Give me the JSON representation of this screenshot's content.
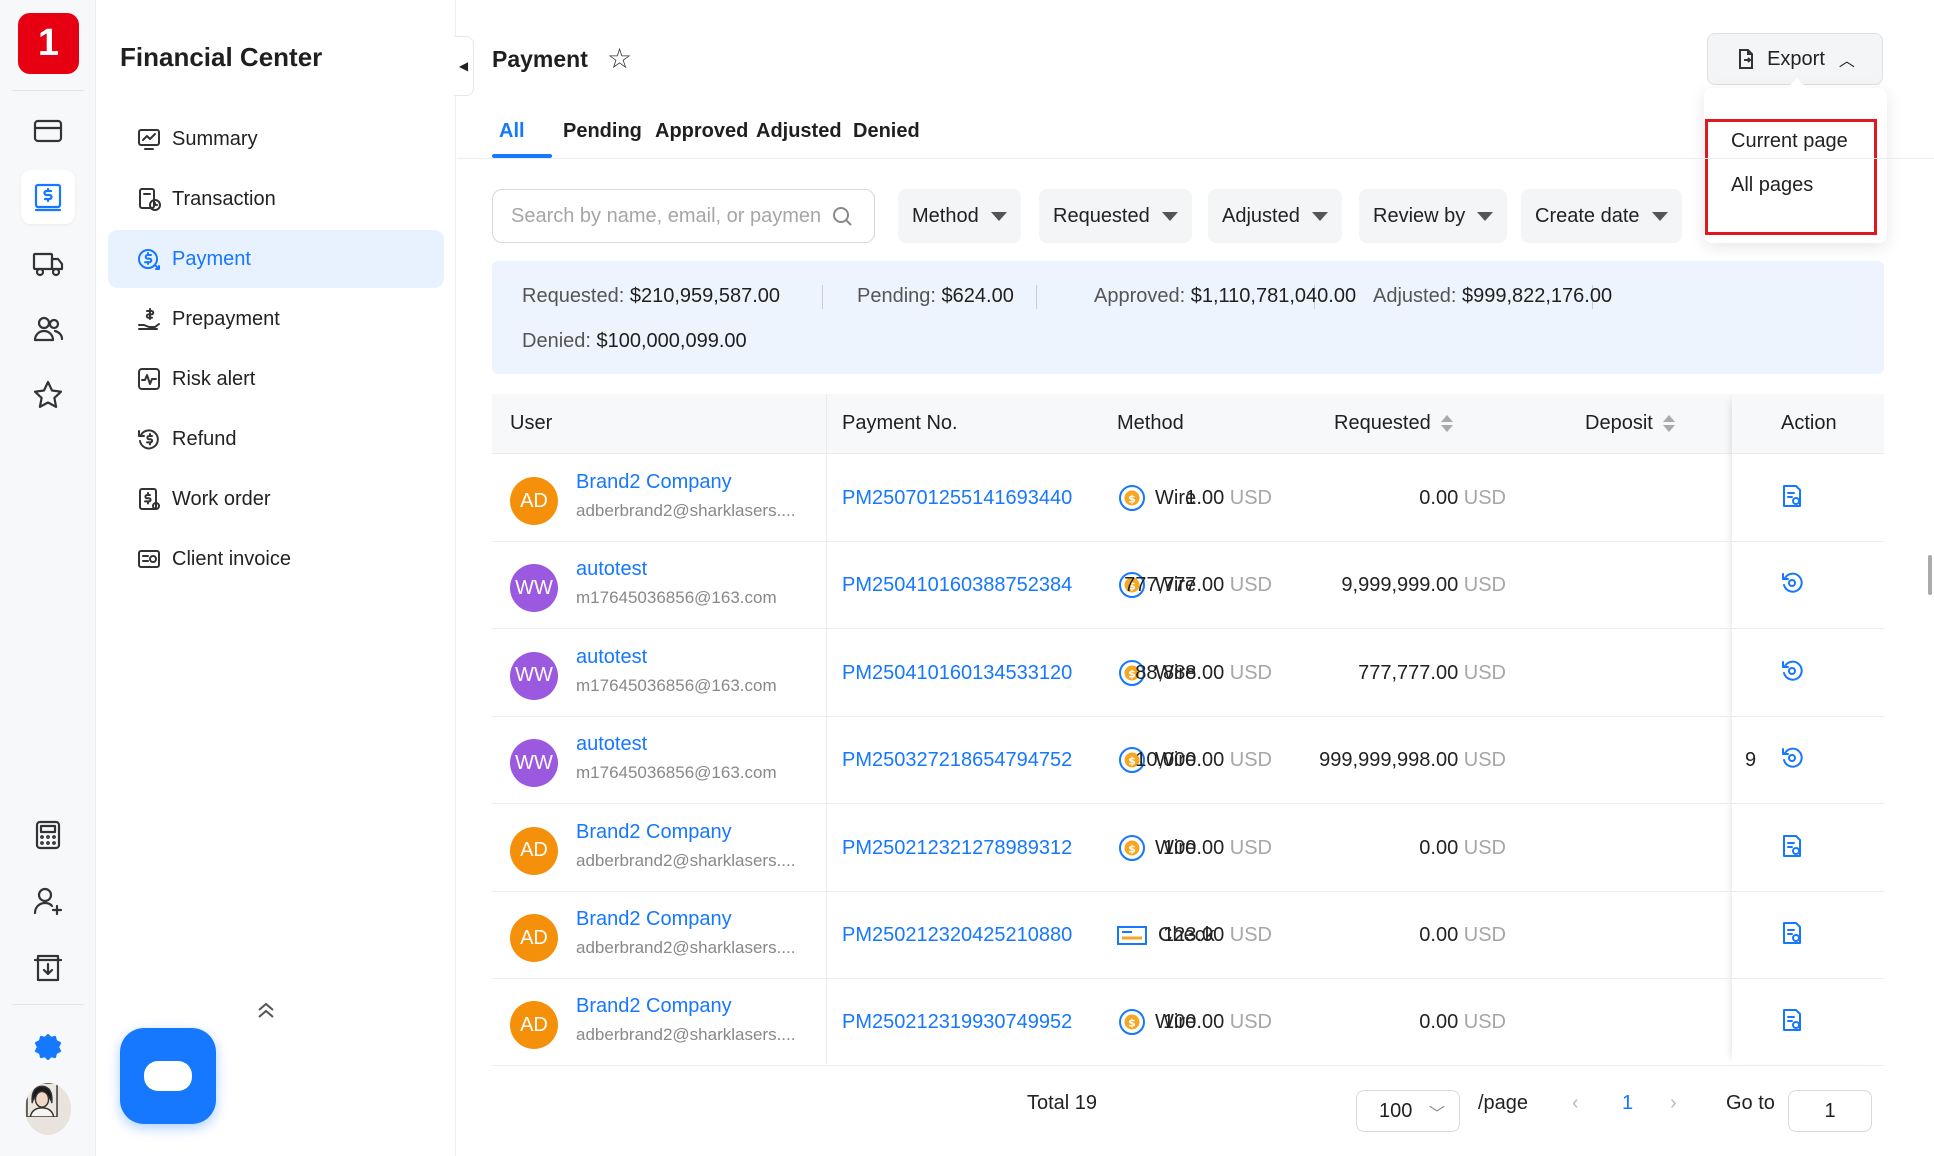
{
  "app": {
    "logo_text": "1",
    "accent": "#1677ff",
    "brand_red": "#e60012"
  },
  "rail": {
    "items": [
      {
        "icon": "card-icon"
      },
      {
        "icon": "dollar-doc-icon",
        "active": true
      },
      {
        "icon": "truck-icon"
      },
      {
        "icon": "users-icon"
      },
      {
        "icon": "star-icon"
      }
    ],
    "bottom_items": [
      {
        "icon": "calculator-icon"
      },
      {
        "icon": "add-user-icon"
      },
      {
        "icon": "download-box-icon"
      },
      {
        "icon": "settings-gear-icon"
      }
    ]
  },
  "sidenav": {
    "title": "Financial Center",
    "items": [
      {
        "label": "Summary",
        "icon": "chart-icon"
      },
      {
        "label": "Transaction",
        "icon": "transaction-icon"
      },
      {
        "label": "Payment",
        "icon": "payment-icon",
        "active": true
      },
      {
        "label": "Prepayment",
        "icon": "prepayment-icon"
      },
      {
        "label": "Risk alert",
        "icon": "risk-icon"
      },
      {
        "label": "Refund",
        "icon": "refund-icon"
      },
      {
        "label": "Work order",
        "icon": "work-order-icon"
      },
      {
        "label": "Client invoice",
        "icon": "invoice-icon"
      }
    ]
  },
  "header": {
    "title": "Payment",
    "export_label": "Export",
    "export_menu": [
      "Current page",
      "All pages"
    ]
  },
  "tabs": [
    "All",
    "Pending",
    "Approved",
    "Adjusted",
    "Denied"
  ],
  "filters": {
    "search_placeholder": "Search by name, email, or paymen",
    "items": [
      "Method",
      "Requested",
      "Adjusted",
      "Review by",
      "Create date"
    ]
  },
  "summary": {
    "requested": {
      "label": "Requested:",
      "value": "$210,959,587.00"
    },
    "pending": {
      "label": "Pending:",
      "value": "$624.00"
    },
    "approved": {
      "label": "Approved:",
      "value": "$1,110,781,040.00"
    },
    "adjusted": {
      "label": "Adjusted:",
      "value": "$999,822,176.00"
    },
    "denied": {
      "label": "Denied:",
      "value": "$100,000,099.00"
    }
  },
  "table": {
    "columns": [
      "User",
      "Payment No.",
      "Method",
      "Requested",
      "Deposit",
      "Action"
    ],
    "currency": "USD",
    "rows": [
      {
        "initials": "AD",
        "avatar_color": "#f5900a",
        "name": "Brand2 Company",
        "email": "adberbrand2@sharklasers....",
        "payment_no": "PM250701255141693440",
        "method": "Wire",
        "method_icon": "wire-icon",
        "requested": "1.00",
        "deposit": "0.00",
        "overflow": "",
        "action_icon": "document-action-icon"
      },
      {
        "initials": "WW",
        "avatar_color": "#9b59e0",
        "name": "autotest",
        "email": "m17645036856@163.com",
        "payment_no": "PM250410160388752384",
        "method": "Wire",
        "method_icon": "wire-icon",
        "requested": "777,777.00",
        "deposit": "9,999,999.00",
        "overflow": "",
        "action_icon": "review-action-icon"
      },
      {
        "initials": "WW",
        "avatar_color": "#9b59e0",
        "name": "autotest",
        "email": "m17645036856@163.com",
        "payment_no": "PM250410160134533120",
        "method": "Wire",
        "method_icon": "wire-icon",
        "requested": "88,888.00",
        "deposit": "777,777.00",
        "overflow": "",
        "action_icon": "review-action-icon"
      },
      {
        "initials": "WW",
        "avatar_color": "#9b59e0",
        "name": "autotest",
        "email": "m17645036856@163.com",
        "payment_no": "PM250327218654794752",
        "method": "Wire",
        "method_icon": "wire-icon",
        "requested": "10,000.00",
        "deposit": "999,999,998.00",
        "overflow": "9",
        "action_icon": "review-action-icon"
      },
      {
        "initials": "AD",
        "avatar_color": "#f5900a",
        "name": "Brand2 Company",
        "email": "adberbrand2@sharklasers....",
        "payment_no": "PM250212321278989312",
        "method": "Wire",
        "method_icon": "wire-icon",
        "requested": "100.00",
        "deposit": "0.00",
        "overflow": "",
        "action_icon": "document-action-icon"
      },
      {
        "initials": "AD",
        "avatar_color": "#f5900a",
        "name": "Brand2 Company",
        "email": "adberbrand2@sharklasers....",
        "payment_no": "PM250212320425210880",
        "method": "Check",
        "method_icon": "check-icon",
        "requested": "123.00",
        "deposit": "0.00",
        "overflow": "",
        "action_icon": "document-action-icon"
      },
      {
        "initials": "AD",
        "avatar_color": "#f5900a",
        "name": "Brand2 Company",
        "email": "adberbrand2@sharklasers....",
        "payment_no": "PM250212319930749952",
        "method": "Wire",
        "method_icon": "wire-icon",
        "requested": "100.00",
        "deposit": "0.00",
        "overflow": "",
        "action_icon": "document-action-icon"
      }
    ]
  },
  "pagination": {
    "total_label": "Total 19",
    "page_size": "100",
    "per_page_label": "/page",
    "current_page": "1",
    "goto_label": "Go to",
    "goto_value": "1"
  }
}
